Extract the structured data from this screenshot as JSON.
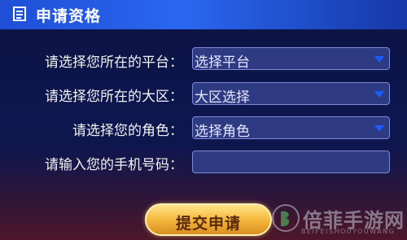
{
  "header": {
    "title": "申请资格",
    "icon": "document-icon"
  },
  "form": {
    "platform": {
      "label": "请选择您所在的平台：",
      "value": "选择平台"
    },
    "region": {
      "label": "请选择您所在的大区：",
      "value": "大区选择"
    },
    "role": {
      "label": "请选择您的角色：",
      "value": "选择角色"
    },
    "phone": {
      "label": "请输入您的手机号码：",
      "value": ""
    }
  },
  "actions": {
    "submit_label": "提交申请"
  },
  "watermark": {
    "text": "倍菲手游网",
    "subtext": "BEIFEISHOUYOUWANG"
  },
  "colors": {
    "title_bar": "#2a67f0",
    "field_bg": "#2e3a82",
    "caret": "#1a5cff",
    "button": "#f5b83e"
  }
}
